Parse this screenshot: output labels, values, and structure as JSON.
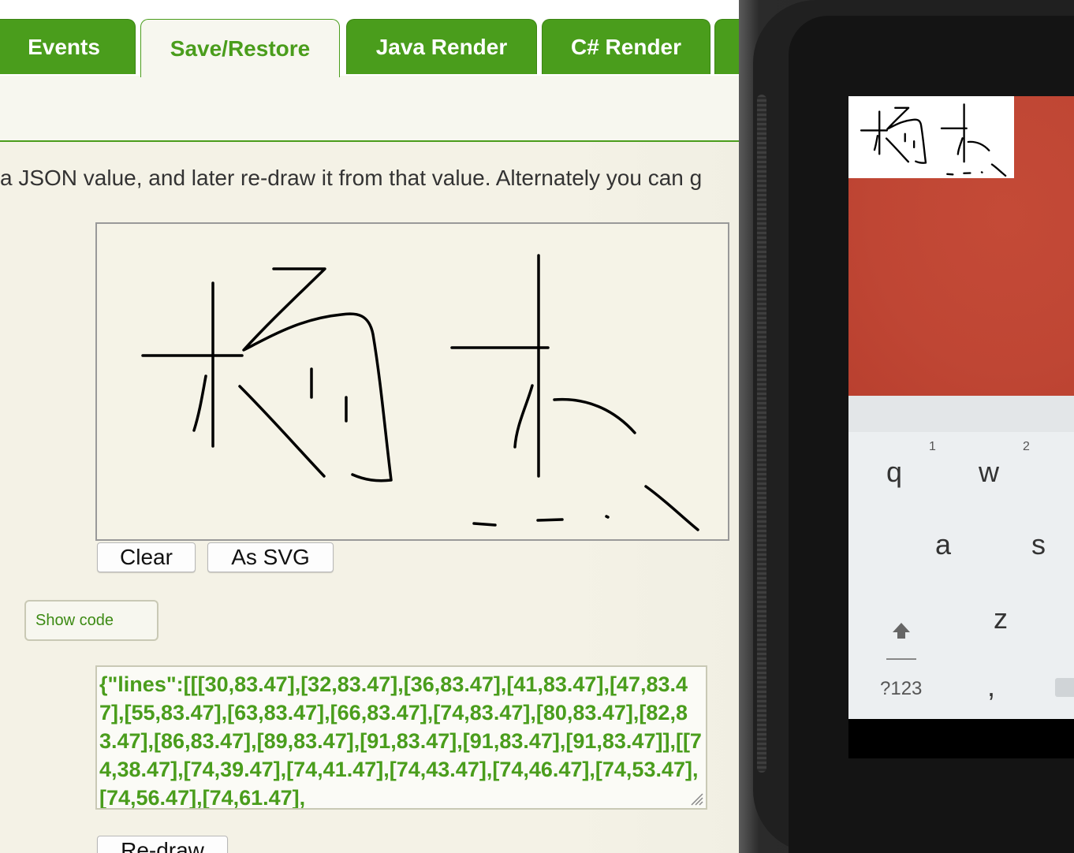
{
  "tabs": [
    {
      "label": "Events"
    },
    {
      "label": "Save/Restore"
    },
    {
      "label": "Java Render"
    },
    {
      "label": "C# Render"
    }
  ],
  "intro_text": "a JSON value, and later re-draw it from that value. Alternately you can g",
  "buttons": {
    "clear": "Clear",
    "as_svg": "As SVG",
    "show_code": "Show code",
    "redraw": "Re-draw"
  },
  "json_value": "{\"lines\":[[[30,83.47],[32,83.47],[36,83.47],[41,83.47],[47,83.47],[55,83.47],[63,83.47],[66,83.47],[74,83.47],[80,83.47],[82,83.47],[86,83.47],[89,83.47],[91,83.47],[91,83.47],[91,83.47]],[[74,38.47],[74,39.47],[74,41.47],[74,43.47],[74,46.47],[74,53.47],[74,56.47],[74,61.47],",
  "keyboard": {
    "row1": [
      {
        "key": "q",
        "hint": "1"
      },
      {
        "key": "w",
        "hint": "2"
      }
    ],
    "row2": [
      "a",
      "s"
    ],
    "row3": [
      "z"
    ],
    "row4": [
      "?123",
      ","
    ]
  },
  "colors": {
    "accent": "#4a9d1c",
    "page_bg": "#f4f2e6",
    "phone_red": "#c0473a"
  }
}
